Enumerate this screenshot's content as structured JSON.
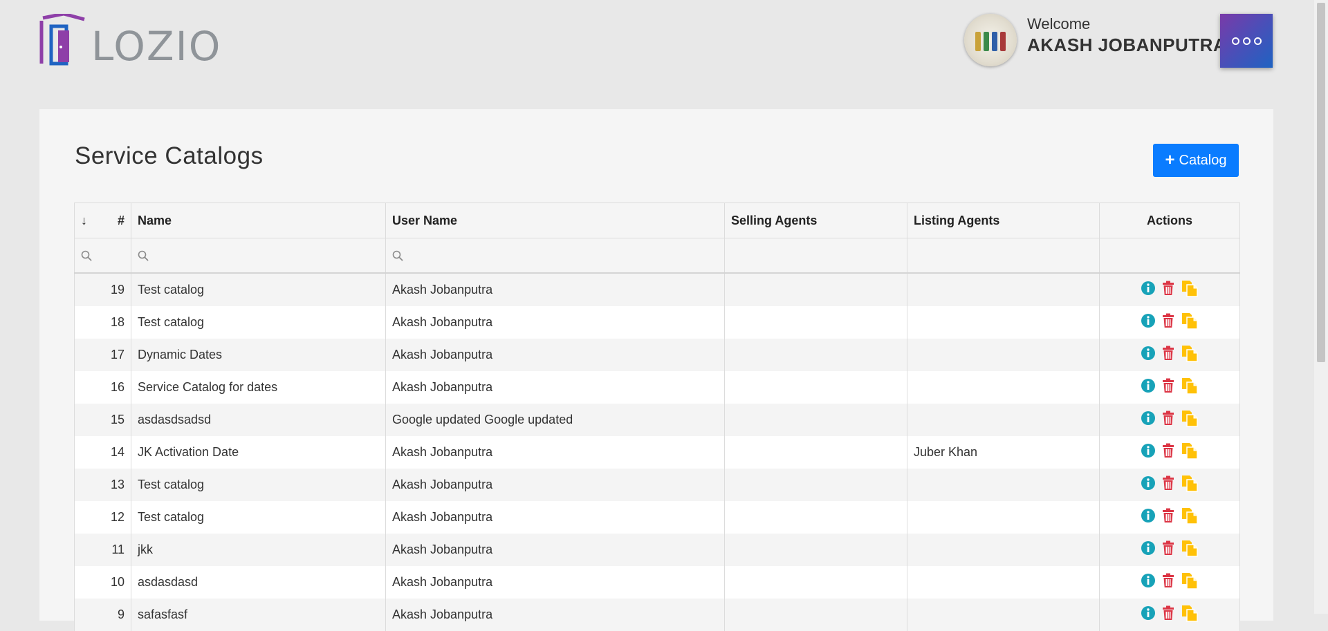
{
  "brand": {
    "logo_text": "LOZIO"
  },
  "header": {
    "welcome_label": "Welcome",
    "user_name": "AKASH JOBANPUTRA"
  },
  "page": {
    "title": "Service Catalogs",
    "add_button_label": "Catalog"
  },
  "table": {
    "columns": {
      "sort": "↓",
      "number": "#",
      "name": "Name",
      "user_name": "User Name",
      "selling_agents": "Selling Agents",
      "listing_agents": "Listing Agents",
      "actions": "Actions"
    },
    "rows": [
      {
        "id": "19",
        "name": "Test catalog",
        "user": "Akash Jobanputra",
        "selling": "",
        "listing": ""
      },
      {
        "id": "18",
        "name": "Test catalog",
        "user": "Akash Jobanputra",
        "selling": "",
        "listing": ""
      },
      {
        "id": "17",
        "name": "Dynamic Dates",
        "user": "Akash Jobanputra",
        "selling": "",
        "listing": ""
      },
      {
        "id": "16",
        "name": "Service Catalog for dates",
        "user": "Akash Jobanputra",
        "selling": "",
        "listing": ""
      },
      {
        "id": "15",
        "name": "asdasdsadsd",
        "user": "Google updated Google updated",
        "selling": "",
        "listing": ""
      },
      {
        "id": "14",
        "name": "JK Activation Date",
        "user": "Akash Jobanputra",
        "selling": "",
        "listing": "Juber Khan"
      },
      {
        "id": "13",
        "name": "Test catalog",
        "user": "Akash Jobanputra",
        "selling": "",
        "listing": ""
      },
      {
        "id": "12",
        "name": "Test catalog",
        "user": "Akash Jobanputra",
        "selling": "",
        "listing": ""
      },
      {
        "id": "11",
        "name": "jkk",
        "user": "Akash Jobanputra",
        "selling": "",
        "listing": ""
      },
      {
        "id": "10",
        "name": "asdasdasd",
        "user": "Akash Jobanputra",
        "selling": "",
        "listing": ""
      },
      {
        "id": "9",
        "name": "safasfasf",
        "user": "Akash Jobanputra",
        "selling": "",
        "listing": ""
      }
    ],
    "action_icons": [
      "info-icon",
      "trash-icon",
      "copy-icon"
    ]
  },
  "colors": {
    "primary_button": "#0a7cff",
    "info": "#17a2b8",
    "delete": "#dc3545",
    "copy": "#ffc107",
    "logo_purple": "#8e3fa8",
    "logo_blue": "#1f63c2"
  }
}
